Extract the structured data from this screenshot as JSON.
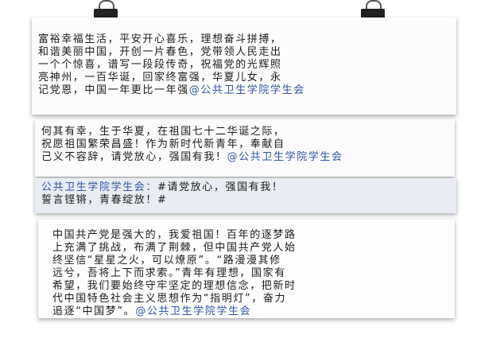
{
  "notes": [
    {
      "text": "富裕幸福生活，平安开心喜乐，理想奋斗拼搏，\n和谐美丽中国，开创一片春色，党带领人民走出\n一个个惊喜，谱写一段段传奇，祝福党的光辉照\n亮神州，一百华诞，回家终富强，华夏儿女，永\n记党恩，中国一年更比一年强",
      "tag": "@公共卫生学院学生会"
    },
    {
      "text": "何其有幸，生于华夏，在祖国七十二华诞之际，\n祝愿祖国繁荣昌盛！作为新时代新青年，奉献自\n己义不容辞，请党放心，强国有我！",
      "tag": "@公共卫生学院学生会"
    },
    {
      "tag": "公共卫生学院学生会：",
      "text": "#请党放心，强国有我！\n誓言铿锵，青春绽放！#"
    },
    {
      "text": "中国共产党是强大的，我爱祖国！百年的逐梦路\n上充满了挑战，布满了荆棘，但中国共产党人始\n终坚信“星星之火，可以燎原”。“路漫漫其修\n远兮，吾将上下而求索。”青年有理想，国家有\n希望，我们要始终守牢坚定的理想信念，把新时\n代中国特色社会主义思想作为“指明灯”，奋力\n追逐“中国梦”。",
      "tag": "@公共卫生学院学生会"
    }
  ]
}
